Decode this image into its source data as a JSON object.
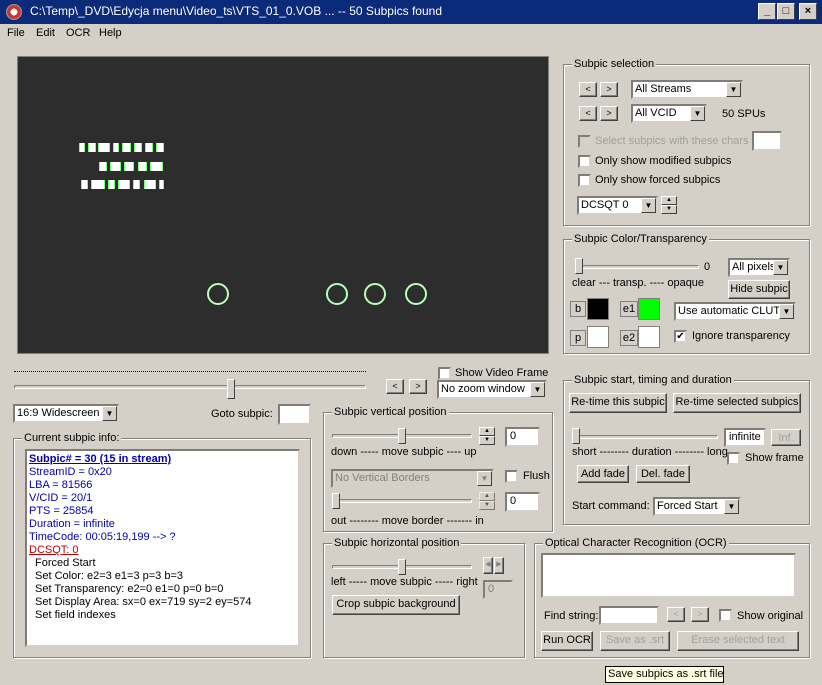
{
  "window": {
    "title": "C:\\Temp\\_DVD\\Edycja menu\\Video_ts\\VTS_01_0.VOB ... -- 50 Subpics found",
    "minimize": "_",
    "maximize": "□",
    "close": "×"
  },
  "menu": [
    "File",
    "Edit",
    "OCR",
    "Help"
  ],
  "nav": {
    "prev": "<",
    "next": ">",
    "zoom": "No zoom window",
    "aspect": "16:9 Widescreen",
    "goto_label": "Goto subpic:",
    "goto_value": "",
    "show_video_frame": "Show Video Frame",
    "show_video_frame_checked": false,
    "timeline_position": 0.62
  },
  "info": {
    "title": "Current subpic info:",
    "lines": {
      "subpic": "Subpic# = 30 (15 in stream)",
      "stream": "StreamID = 0x20",
      "lba": "LBA = 81566",
      "vcid": "V/CID = 20/1",
      "pts": "PTS = 25854",
      "duration": "Duration = infinite",
      "timecode": "TimeCode: 00:05:19,199 --> ?",
      "dcsqt": "DCSQT: 0",
      "cmd1": "Forced Start",
      "cmd2": "Set Color: e2=3 e1=3 p=3 b=3",
      "cmd3": "Set Transparency: e2=0 e1=0 p=0 b=0",
      "cmd4": "Set Display Area: sx=0 ex=719 sy=2 ey=574",
      "cmd5": "Set field indexes"
    }
  },
  "vertical": {
    "title": "Subpic vertical position",
    "move_label": "down ----- move subpic ---- up",
    "move_value": "0",
    "move_position": 0.5,
    "borders_combo": "No Vertical Borders",
    "flush_label": "Flush",
    "border_label": "out -------- move border ------- in",
    "border_value": "0",
    "border_position": 0.0
  },
  "horizontal": {
    "title": "Subpic horizontal position",
    "move_label": "left ----- move subpic ----- right",
    "move_value": "0",
    "move_position": 0.5,
    "crop_button": "Crop subpic background"
  },
  "selection": {
    "title": "Subpic selection",
    "streams": "All Streams",
    "vcid": "All VCID",
    "spus": "50 SPUs",
    "select_chars": "Select subpics with these chars",
    "only_modified": "Only show modified subpics",
    "only_forced": "Only show forced subpics",
    "dcsqt": "DCSQT 0"
  },
  "color": {
    "title": "Subpic Color/Transparency",
    "value": "0",
    "label": "clear --- transp. ---- opaque",
    "pixels": "All pixels",
    "hide": "Hide subpic",
    "clut": "Use automatic CLUT",
    "ignore": "Ignore transparency",
    "ignore_checked": true,
    "b_label": "b",
    "e1_label": "e1",
    "p_label": "p",
    "e2_label": "e2",
    "b_color": "#000000",
    "e1_color": "#00ff00",
    "p_color": "#ffffff",
    "e2_color": "#ffffff"
  },
  "timing": {
    "title": "Subpic start, timing and duration",
    "retime": "Re-time this subpic",
    "retime_selected": "Re-time selected subpics",
    "duration_value": "infinite",
    "inf": "Inf.",
    "duration_label": "short -------- duration -------- long",
    "show_frame": "Show frame",
    "add_fade": "Add fade",
    "del_fade": "Del. fade",
    "start_label": "Start command:",
    "start_value": "Forced Start"
  },
  "ocr": {
    "title": "Optical Character Recognition (OCR)",
    "find_label": "Find string:",
    "show_original": "Show original",
    "run": "Run OCR",
    "save": "Save as .srt",
    "erase": "Erase selected text",
    "tooltip": "Save subpics as .srt file"
  },
  "colors": {
    "titlebar": "#0b2a7a",
    "face": "#d4d0c8",
    "preview_bg": "#2d2d2d",
    "subpic_green": "#00ff00"
  }
}
